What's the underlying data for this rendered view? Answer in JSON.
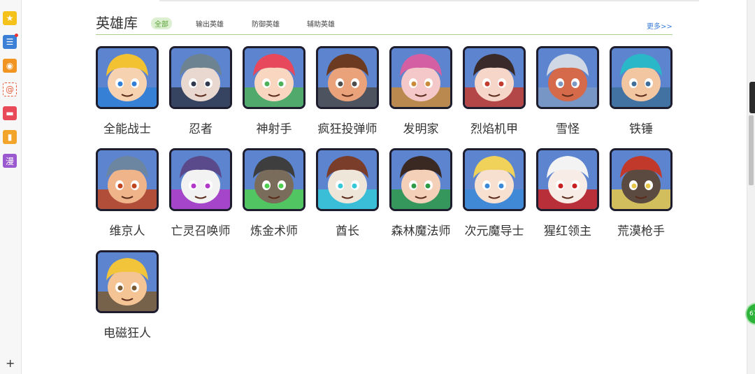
{
  "header": {
    "title": "英雄库",
    "tabs": [
      "全部",
      "输出英雄",
      "防御英雄",
      "辅助英雄"
    ],
    "more": "更多>>"
  },
  "sidebar": {
    "icons": [
      "star-icon",
      "news-icon",
      "weibo-icon",
      "mail-icon",
      "game-icon",
      "book-icon",
      "comic-icon"
    ],
    "comic_label": "漫",
    "plus": "+"
  },
  "floating_badge": "67",
  "heroes": [
    {
      "name": "全能战士",
      "skin": "#f7d2b0",
      "hair": "#f2c232",
      "accent": "#2f7fd6"
    },
    {
      "name": "忍者",
      "skin": "#e8d8d0",
      "hair": "#6e8391",
      "accent": "#30384e"
    },
    {
      "name": "神射手",
      "skin": "#f8d6c0",
      "hair": "#e8485c",
      "accent": "#4fb05a"
    },
    {
      "name": "疯狂投弹师",
      "skin": "#e9a27a",
      "hair": "#6b3a20",
      "accent": "#4b4b4b"
    },
    {
      "name": "发明家",
      "skin": "#f4c8c8",
      "hair": "#d45fa2",
      "accent": "#c98a3a"
    },
    {
      "name": "烈焰机甲",
      "skin": "#f5d6c8",
      "hair": "#3a2a2a",
      "accent": "#c23b2f"
    },
    {
      "name": "雪怪",
      "skin": "#d46a4a",
      "hair": "#cfd8e4",
      "accent": "#7b98c3"
    },
    {
      "name": "铁锤",
      "skin": "#f3c6a2",
      "hair": "#2ab7c8",
      "accent": "#3d6f9a"
    },
    {
      "name": "维京人",
      "skin": "#f0b48a",
      "hair": "#6c85a0",
      "accent": "#c0441e"
    },
    {
      "name": "亡灵召唤师",
      "skin": "#f2f2f2",
      "hair": "#5a4a8c",
      "accent": "#b23ac8"
    },
    {
      "name": "炼金术师",
      "skin": "#7a6c5a",
      "hair": "#3e3e3e",
      "accent": "#4fd04f"
    },
    {
      "name": "酋长",
      "skin": "#efe6da",
      "hair": "#7a3d2a",
      "accent": "#34c8d8"
    },
    {
      "name": "森林魔法师",
      "skin": "#f4d0b8",
      "hair": "#3a2822",
      "accent": "#2e9a46"
    },
    {
      "name": "次元魔导士",
      "skin": "#f8e0d0",
      "hair": "#f0d25a",
      "accent": "#3b8ad8"
    },
    {
      "name": "猩红领主",
      "skin": "#f7ece6",
      "hair": "#f3f3f3",
      "accent": "#c82020"
    },
    {
      "name": "荒漠枪手",
      "skin": "#5a4a40",
      "hair": "#c0392b",
      "accent": "#e8c84a"
    },
    {
      "name": "电磁狂人",
      "skin": "#f4c494",
      "hair": "#f2c43a",
      "accent": "#7a5a32"
    }
  ]
}
